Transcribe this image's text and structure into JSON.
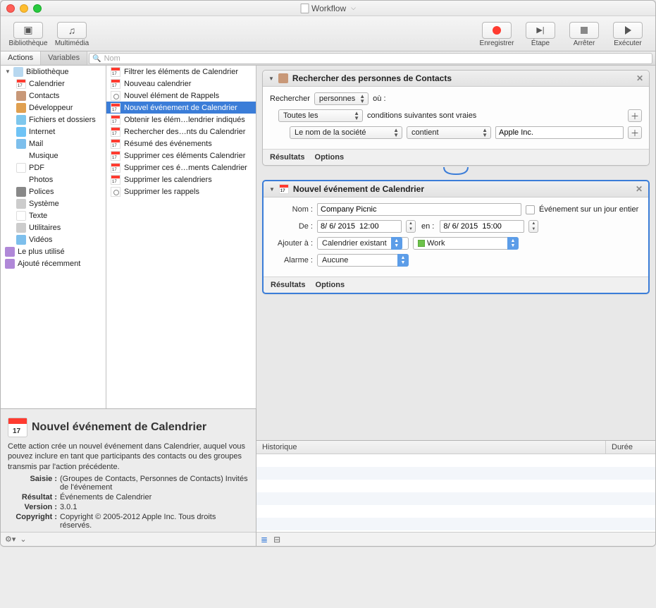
{
  "window": {
    "title": "Workflow"
  },
  "toolbar": {
    "left": [
      {
        "key": "library",
        "label": "Bibliothèque"
      },
      {
        "key": "media",
        "label": "Multimédia"
      }
    ],
    "right": [
      {
        "key": "record",
        "label": "Enregistrer"
      },
      {
        "key": "step",
        "label": "Étape"
      },
      {
        "key": "stop",
        "label": "Arrêter"
      },
      {
        "key": "run",
        "label": "Exécuter"
      }
    ]
  },
  "tabs": {
    "actions": "Actions",
    "variables": "Variables"
  },
  "search": {
    "placeholder": "Nom"
  },
  "library": {
    "root": "Bibliothèque",
    "categories": [
      {
        "key": "calendrier",
        "label": "Calendrier",
        "icon": "icon-cal"
      },
      {
        "key": "contacts",
        "label": "Contacts",
        "icon": "icon-contacts"
      },
      {
        "key": "developpeur",
        "label": "Développeur",
        "icon": "icon-dev"
      },
      {
        "key": "fichiers",
        "label": "Fichiers et dossiers",
        "icon": "icon-files"
      },
      {
        "key": "internet",
        "label": "Internet",
        "icon": "icon-internet"
      },
      {
        "key": "mail",
        "label": "Mail",
        "icon": "icon-mail"
      },
      {
        "key": "musique",
        "label": "Musique",
        "icon": "icon-music"
      },
      {
        "key": "pdf",
        "label": "PDF",
        "icon": "icon-pdf"
      },
      {
        "key": "photos",
        "label": "Photos",
        "icon": "icon-photos"
      },
      {
        "key": "polices",
        "label": "Polices",
        "icon": "icon-fonts"
      },
      {
        "key": "systeme",
        "label": "Système",
        "icon": "icon-system"
      },
      {
        "key": "texte",
        "label": "Texte",
        "icon": "icon-text"
      },
      {
        "key": "utilitaires",
        "label": "Utilitaires",
        "icon": "icon-utils"
      },
      {
        "key": "videos",
        "label": "Vidéos",
        "icon": "icon-videos"
      }
    ],
    "smart": [
      {
        "key": "mostused",
        "label": "Le plus utilisé",
        "icon": "icon-purple"
      },
      {
        "key": "recent",
        "label": "Ajouté récemment",
        "icon": "icon-purple"
      }
    ]
  },
  "actions_list": [
    "Filtrer les éléments de Calendrier",
    "Nouveau calendrier",
    "Nouvel élément de Rappels",
    "Nouvel événement de Calendrier",
    "Obtenir les élém…lendrier indiqués",
    "Rechercher des…nts du Calendrier",
    "Résumé des événements",
    "Supprimer ces éléments Calendrier",
    "Supprimer ces é…ments Calendrier",
    "Supprimer les calendriers",
    "Supprimer les rappels"
  ],
  "actions_selected_index": 3,
  "wf1": {
    "title": "Rechercher des personnes de Contacts",
    "search_label": "Rechercher",
    "search_type": "personnes",
    "where_label": "où :",
    "scope": "Toutes les",
    "conditions_text": "conditions suivantes sont vraies",
    "rule_field": "Le nom de la société",
    "rule_op": "contient",
    "rule_value": "Apple Inc.",
    "results": "Résultats",
    "options": "Options"
  },
  "wf2": {
    "title": "Nouvel événement de Calendrier",
    "name_label": "Nom :",
    "name_value": "Company Picnic",
    "allday_label": "Événement sur un jour entier",
    "from_label": "De :",
    "from_value": "8/ 6/ 2015  12:00",
    "to_label": "en :",
    "to_value": "8/ 6/ 2015  15:00",
    "addto_label": "Ajouter à :",
    "addto_value": "Calendrier existant",
    "calendar_value": "Work",
    "alarm_label": "Alarme :",
    "alarm_value": "Aucune",
    "results": "Résultats",
    "options": "Options"
  },
  "log": {
    "col1": "Historique",
    "col2": "Durée"
  },
  "description": {
    "title": "Nouvel événement de Calendrier",
    "body": "Cette action crée un nouvel événement dans Calendrier, auquel vous pouvez inclure en tant que participants des contacts ou des groupes transmis par l'action précédente.",
    "input_label": "Saisie :",
    "input_value": "(Groupes de Contacts, Personnes de Contacts) Invités de l'événement",
    "result_label": "Résultat :",
    "result_value": "Événements de Calendrier",
    "version_label": "Version :",
    "version_value": "3.0.1",
    "copyright_label": "Copyright :",
    "copyright_value": "Copyright © 2005-2012 Apple Inc. Tous droits réservés."
  }
}
